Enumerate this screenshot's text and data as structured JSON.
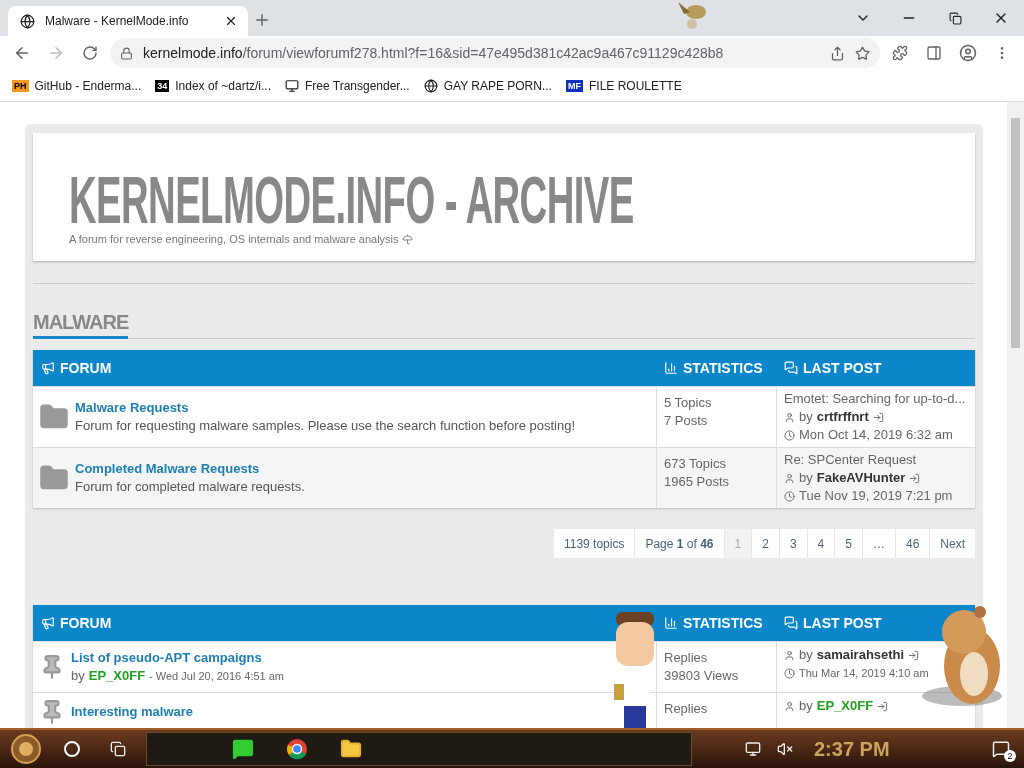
{
  "browser": {
    "tab_title": "Malware - KernelMode.info",
    "url_domain": "kernelmode.info",
    "url_path": "/forum/viewforumf278.html?f=16&sid=47e495d381c42ac9a467c91129c428b8",
    "bookmarks": [
      {
        "kind": "badge",
        "badge": "PH",
        "label": "GitHub - Enderma..."
      },
      {
        "kind": "badge",
        "badge": "34",
        "label": "Index of ~dartz/i..."
      },
      {
        "kind": "computer",
        "label": "Free Transgender..."
      },
      {
        "kind": "globe",
        "label": "GAY RAPE PORN..."
      },
      {
        "kind": "badge",
        "badge": "MF",
        "label": "FILE ROULETTE"
      }
    ]
  },
  "site": {
    "title": "KERNELMODE.INFO - ARCHIVE",
    "tagline": "A forum for reverse engineering, OS internals and malware analysis"
  },
  "section": {
    "title": "MALWARE"
  },
  "forums_table": {
    "headers": [
      "FORUM",
      "STATISTICS",
      "LAST POST"
    ],
    "rows": [
      {
        "name": "Malware Requests",
        "description": "Forum for requesting malware samples. Please use the search function before posting!",
        "topics": "5 Topics",
        "posts": "7 Posts",
        "last_title": "Emotet: Searching for up-to-d...",
        "by": "by",
        "last_author": "crtfrffnrt",
        "last_time": "Mon Oct 14, 2019 6:32 am"
      },
      {
        "name": "Completed Malware Requests",
        "description": "Forum for completed malware requests.",
        "topics": "673 Topics",
        "posts": "1965 Posts",
        "last_title": "Re: SPCenter Request",
        "by": "by",
        "last_author": "FakeAVHunter",
        "last_time": "Tue Nov 19, 2019 7:21 pm"
      }
    ]
  },
  "pagination": {
    "total": "1139 topics",
    "page_label": "Page **1** of **46**",
    "pages": [
      {
        "label": "1",
        "selected": true
      },
      {
        "label": "2",
        "selected": false
      },
      {
        "label": "3",
        "selected": false
      },
      {
        "label": "4",
        "selected": false
      },
      {
        "label": "5",
        "selected": false
      },
      {
        "label": "…",
        "selected": false
      },
      {
        "label": "46",
        "selected": false
      }
    ],
    "next": "Next"
  },
  "topics_table": {
    "headers": [
      "FORUM",
      "STATISTICS",
      "LAST POST"
    ],
    "rows": [
      {
        "title": "List of pseudo-APT campaigns",
        "by": "by",
        "author": "EP_X0FF",
        "time": "- Wed Jul 20, 2016 4:51 am",
        "replies": "Replies",
        "views": "39803 Views",
        "last_by": "by",
        "last_author": "samairahsethi",
        "last_time": "Thu Mar 14, 2019 4:10 am"
      },
      {
        "title": "Interesting malware",
        "replies": "Replies",
        "last_by": "by",
        "last_author": "EP_X0FF"
      }
    ]
  },
  "taskbar": {
    "time": "2:37 PM",
    "notifications": "2"
  }
}
